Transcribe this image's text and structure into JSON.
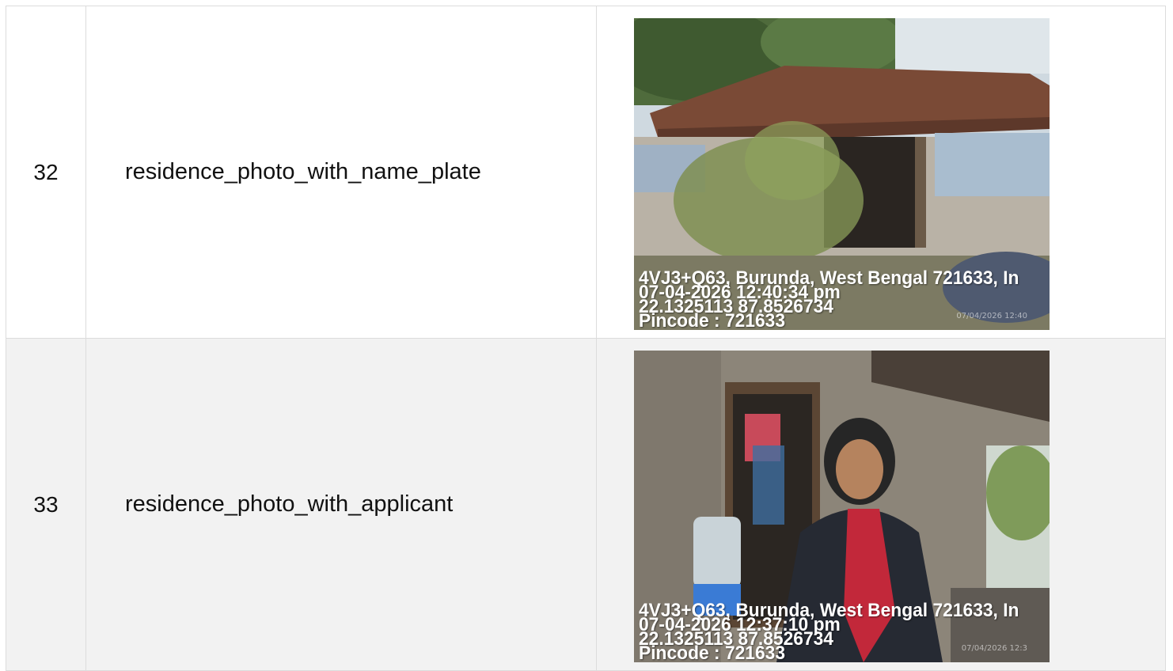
{
  "rows": [
    {
      "number": "32",
      "label": "residence_photo_with_name_plate",
      "photo": {
        "description_icon": "house-photo",
        "overlay_lines": [
          "4VJ3+Q63, Burunda, West Bengal 721633, In",
          "07-04-2026 12:40:34 pm",
          "22.1325113 87.8526734",
          "Pincode : 721633"
        ],
        "stamp": "07/04/2026  12:40"
      }
    },
    {
      "number": "33",
      "label": "residence_photo_with_applicant",
      "photo": {
        "description_icon": "applicant-photo",
        "overlay_lines": [
          "4VJ3+Q63, Burunda, West Bengal 721633, In",
          "07-04-2026 12:37:10 pm",
          "22.1325113 87.8526734",
          "Pincode : 721633"
        ],
        "stamp": "07/04/2026  12:3"
      }
    }
  ],
  "colors": {
    "border": "#dcdcdc",
    "row_alt_bg": "#f2f2f2",
    "text": "#111111"
  }
}
